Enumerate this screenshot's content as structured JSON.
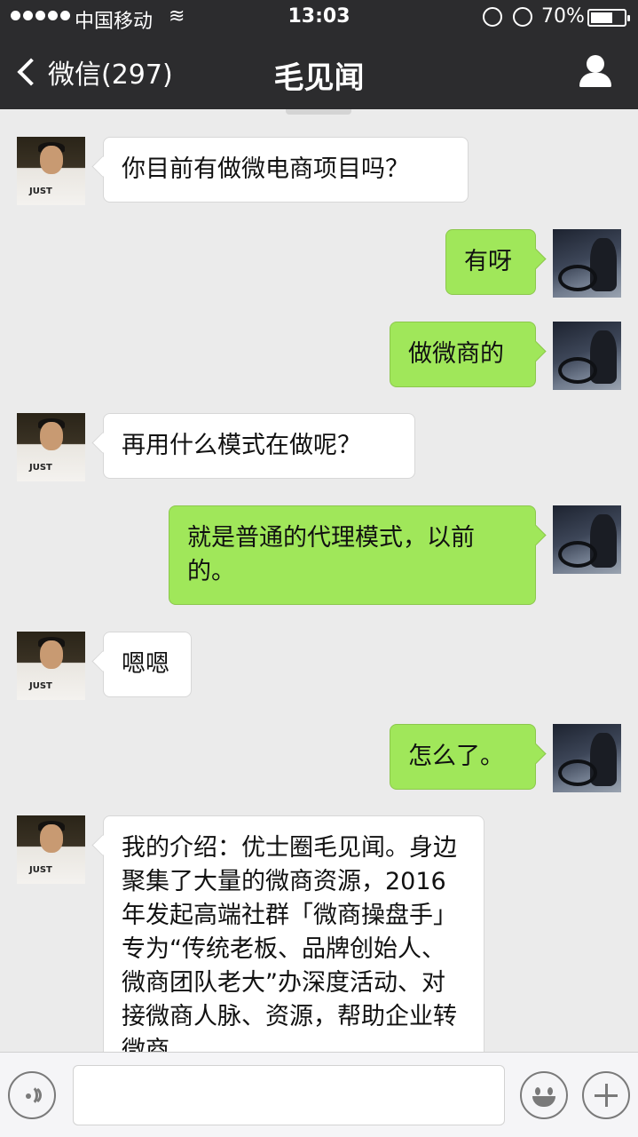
{
  "status_bar": {
    "carrier": "中国移动",
    "time": "13:03",
    "battery": "70%",
    "battery_level": 0.7,
    "signal_icon": "signal-dots-icon",
    "wifi_icon": "wifi-icon"
  },
  "nav": {
    "back_label": "微信(297)",
    "title": "毛见闻",
    "profile_icon": "profile-icon"
  },
  "messages": [
    {
      "side": "left",
      "text": "你目前有做微电商项目吗？"
    },
    {
      "side": "right",
      "text": "有呀"
    },
    {
      "side": "right",
      "text": "做微商的"
    },
    {
      "side": "left",
      "text": "再用什么模式在做呢？"
    },
    {
      "side": "right",
      "text": "就是普通的代理模式，以前的。"
    },
    {
      "side": "left",
      "text": "嗯嗯"
    },
    {
      "side": "right",
      "text": "怎么了。"
    },
    {
      "side": "left",
      "text": "我的介绍：优士圈毛见闻。身边聚集了大量的微商资源，2016年发起高端社群「微商操盘手」专为“传统老板、品牌创始人、微商团队老大”办深度活动、对接微商人脉、资源，帮助企业转微商"
    }
  ],
  "input_bar": {
    "voice_icon": "voice-icon",
    "emoji_icon": "emoji-icon",
    "plus_icon": "plus-icon",
    "input_value": ""
  },
  "colors": {
    "nav_bg": "#2c2c2e",
    "chat_bg": "#ebebeb",
    "bubble_self": "#a0e75a",
    "bubble_other": "#ffffff"
  }
}
